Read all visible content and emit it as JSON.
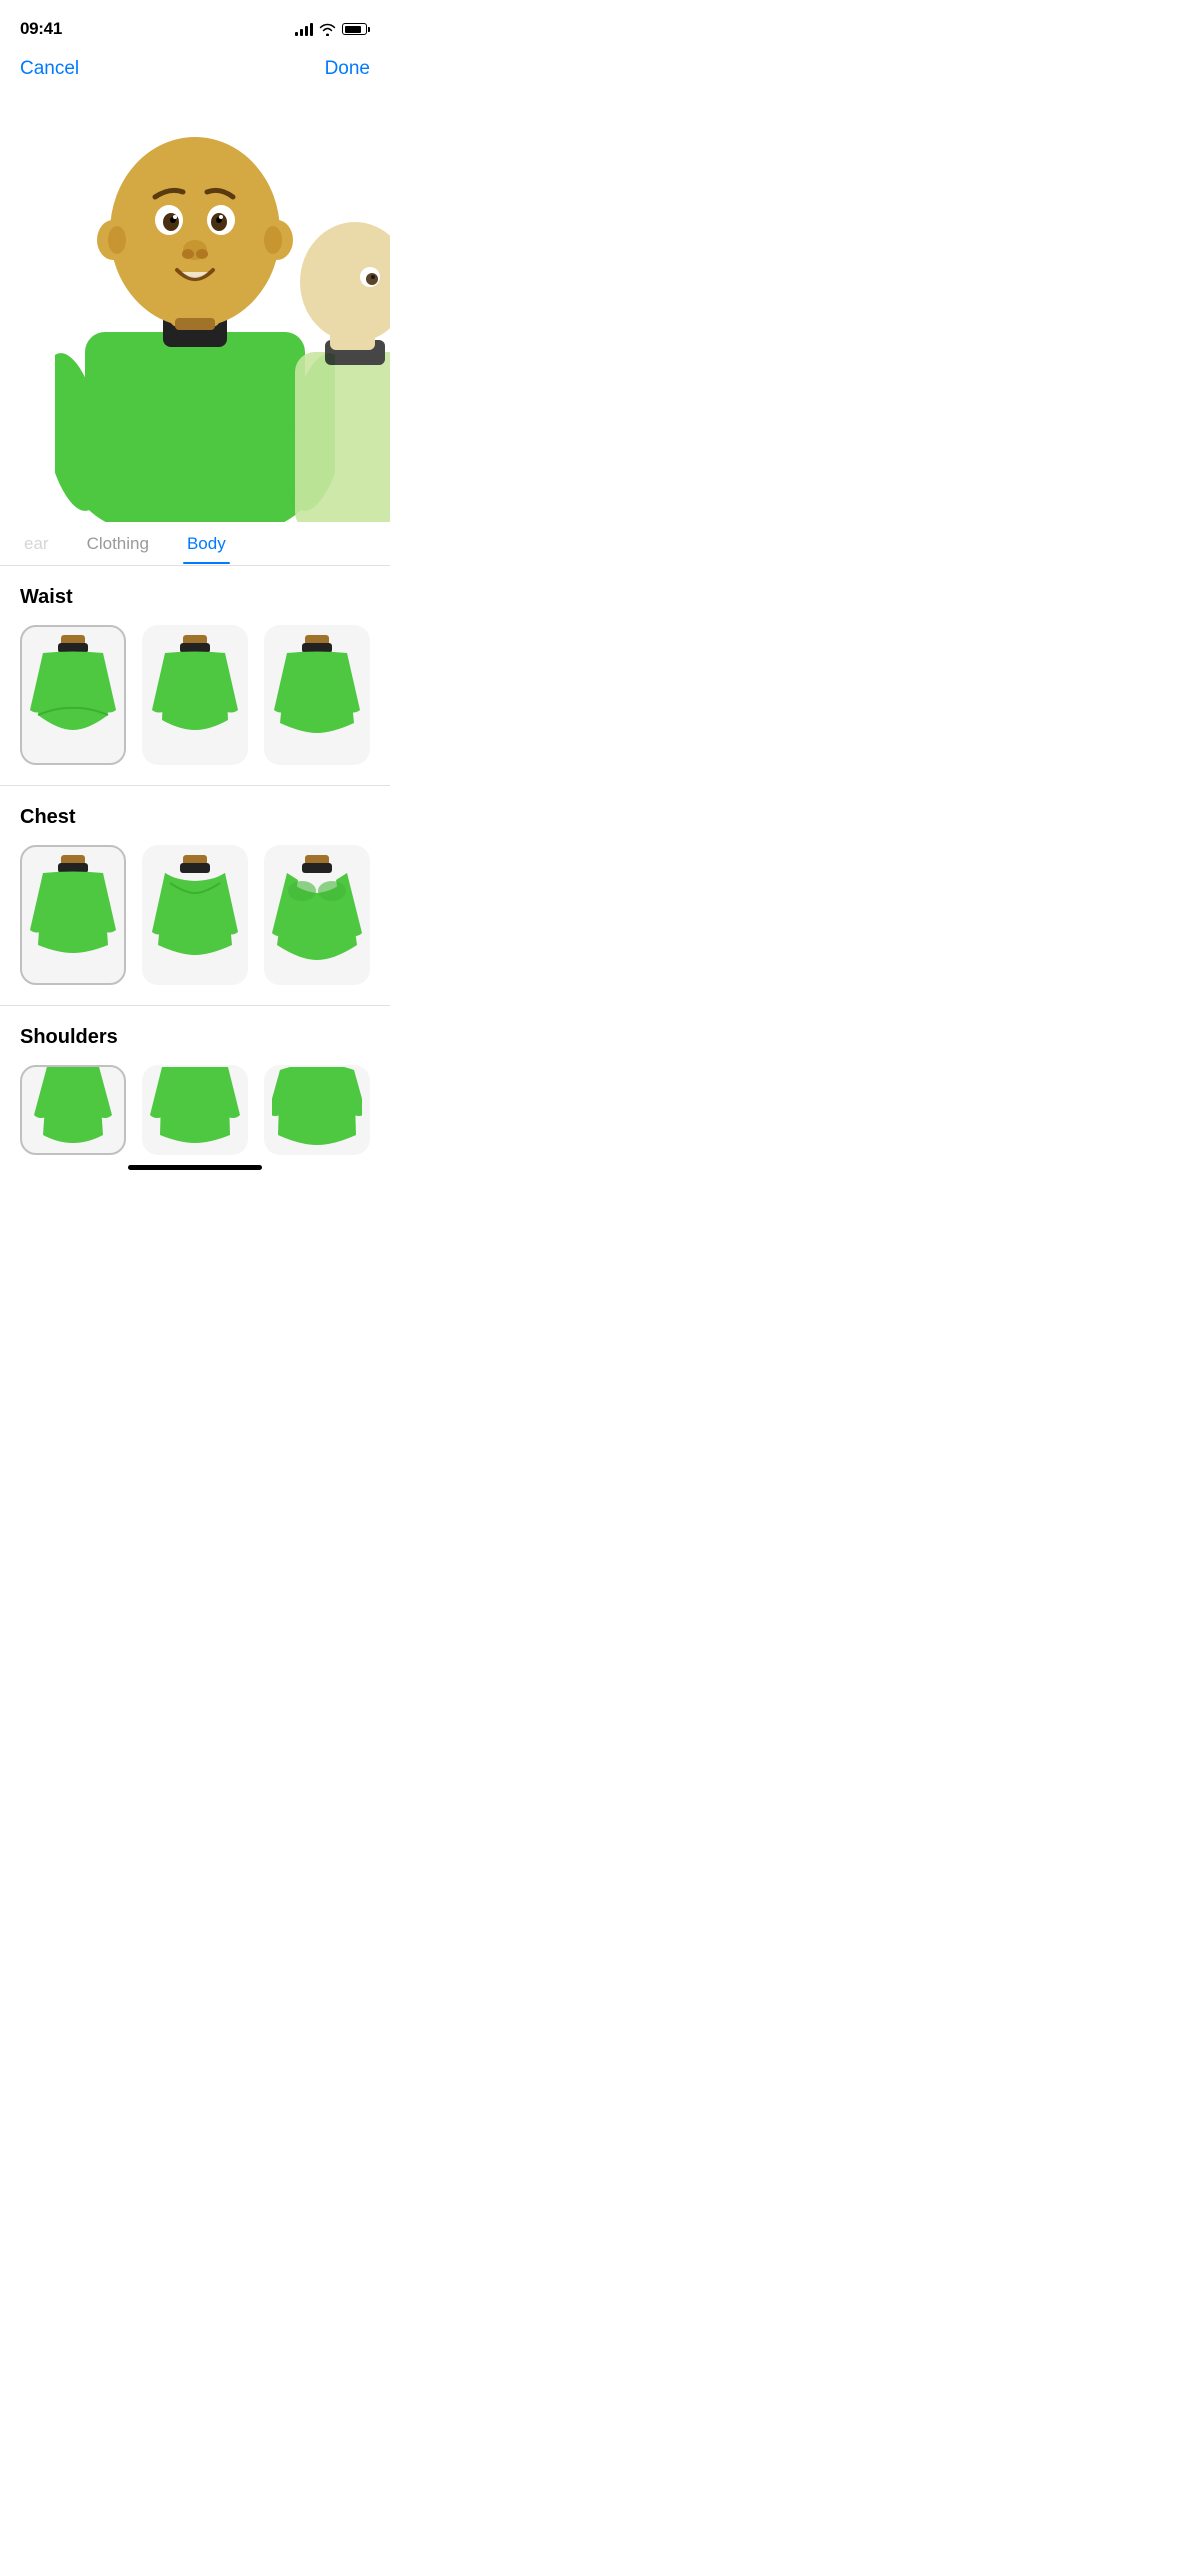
{
  "status": {
    "time": "09:41"
  },
  "nav": {
    "cancel_label": "Cancel",
    "done_label": "Done"
  },
  "tabs": [
    {
      "id": "headwear",
      "label": "ear",
      "active": false,
      "partial": true
    },
    {
      "id": "clothing",
      "label": "Clothing",
      "active": false
    },
    {
      "id": "body",
      "label": "Body",
      "active": true
    }
  ],
  "sections": [
    {
      "id": "waist",
      "title": "Waist",
      "options": [
        {
          "id": "waist-1",
          "selected": true
        },
        {
          "id": "waist-2",
          "selected": false
        },
        {
          "id": "waist-3",
          "selected": false
        }
      ]
    },
    {
      "id": "chest",
      "title": "Chest",
      "options": [
        {
          "id": "chest-1",
          "selected": true
        },
        {
          "id": "chest-2",
          "selected": false
        },
        {
          "id": "chest-3",
          "selected": false
        }
      ]
    },
    {
      "id": "shoulders",
      "title": "Shoulders",
      "options": [
        {
          "id": "shoulders-1",
          "selected": true
        },
        {
          "id": "shoulders-2",
          "selected": false
        },
        {
          "id": "shoulders-3",
          "selected": false
        }
      ]
    }
  ],
  "colors": {
    "accent": "#007AFF",
    "green": "#4CAF50",
    "green_bright": "#5DC94E",
    "collar": "#222",
    "neck_brown": "#A0722A",
    "skin": "#D4A843",
    "skin_light": "#E8D5A0"
  }
}
